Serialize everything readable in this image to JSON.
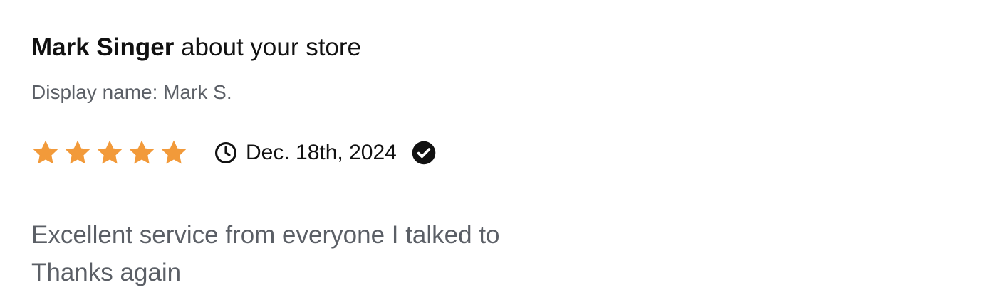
{
  "review": {
    "author": "Mark Singer",
    "title_suffix": " about your store",
    "display_name": "Display name: Mark S.",
    "rating": 5,
    "rating_max": 5,
    "date": "Dec. 18th, 2024",
    "body_lines": [
      "Excellent service from everyone I talked to",
      "Thanks again"
    ]
  },
  "icons": {
    "star": "star-icon",
    "clock": "clock-icon",
    "verified": "check-circle-icon"
  },
  "colors": {
    "star": "#F29A3A",
    "text_primary": "#111111",
    "text_secondary": "#5B5F66"
  }
}
